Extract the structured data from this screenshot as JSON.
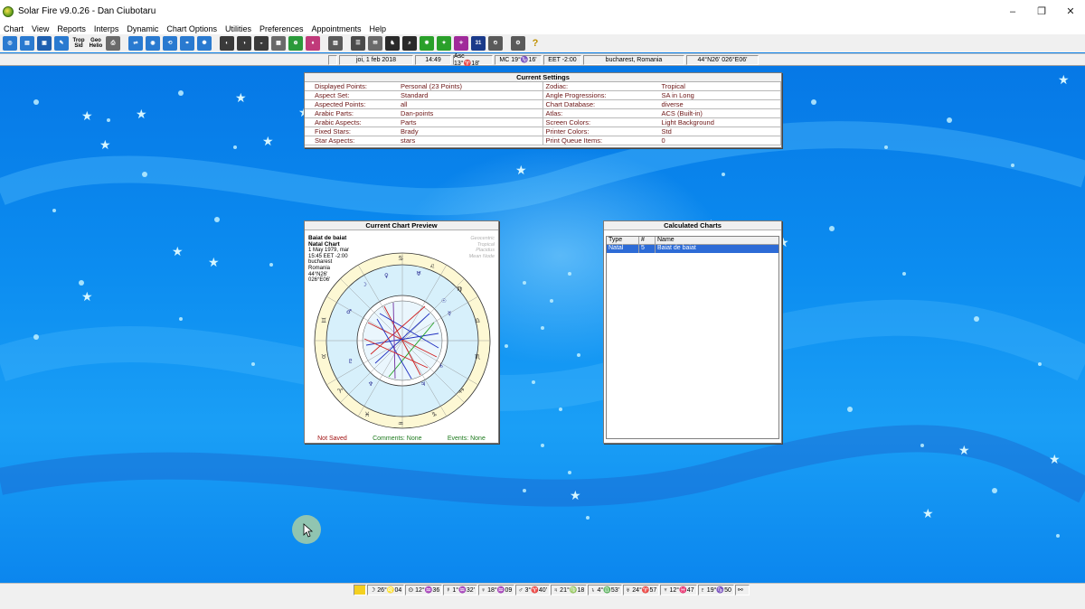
{
  "window": {
    "title": "Solar Fire v9.0.26  -  Dan Ciubotaru",
    "controls": [
      "–",
      "❐",
      "✕"
    ]
  },
  "menu": [
    "Chart",
    "View",
    "Reports",
    "Interps",
    "Dynamic",
    "Chart Options",
    "Utilities",
    "Preferences",
    "Appointments",
    "Help"
  ],
  "toolbar": {
    "trop_sid_label": "Trop\nSid",
    "geo_helio_label": "Geo\nHelio"
  },
  "infobar": {
    "date": "joi, 1 feb 2018",
    "time": "14:49",
    "asc": "Asc 13°♈18'",
    "mc": "MC 19°♑16'",
    "tz": "EET -2:00",
    "place": "bucharest, Romania",
    "coords": "44°N26' 026°E06'"
  },
  "settings": {
    "title": "Current Settings",
    "left": [
      {
        "k": "Displayed Points:",
        "v": "Personal  (23 Points)"
      },
      {
        "k": "Aspect Set:",
        "v": "Standard"
      },
      {
        "k": "Aspected Points:",
        "v": "all"
      },
      {
        "k": "Arabic Parts:",
        "v": "Dan-points"
      },
      {
        "k": "Arabic Aspects:",
        "v": "Parts"
      },
      {
        "k": "Fixed Stars:",
        "v": "Brady"
      },
      {
        "k": "Star Aspects:",
        "v": "stars"
      }
    ],
    "right": [
      {
        "k": "Zodiac:",
        "v": "Tropical"
      },
      {
        "k": "Angle Progressions:",
        "v": "SA in Long"
      },
      {
        "k": "Chart Database:",
        "v": "diverse"
      },
      {
        "k": "Atlas:",
        "v": "ACS  (Built-in)"
      },
      {
        "k": "Screen Colors:",
        "v": "Light Background"
      },
      {
        "k": "Printer Colors:",
        "v": "Std"
      },
      {
        "k": "Print Queue Items:",
        "v": "0"
      }
    ]
  },
  "preview": {
    "title": "Current Chart Preview",
    "name": "Baiat de baiat",
    "type": "Natal Chart",
    "date": "1 May 1979, mar",
    "time": "15:45  EET  -2:00",
    "city": "bucharest",
    "country": "Romania",
    "lat": "44°N26'",
    "lon": "026°E06'",
    "opts": [
      "Geocentric",
      "Tropical",
      "Placidus",
      "Mean Node"
    ],
    "footer_saved": "Not Saved",
    "footer_comments": "Comments: None",
    "footer_events": "Events: None"
  },
  "calc": {
    "title": "Calculated Charts",
    "headers": [
      "Type",
      "#",
      "Name"
    ],
    "rows": [
      {
        "type": "Natal",
        "num": "5",
        "name": "Baiat de baiat"
      }
    ]
  },
  "statusbar": [
    "☽ 26°♌04",
    "⊙ 12°♒36",
    "☿ 1°♒32'",
    "♀ 18°♒09",
    "♂ 3°♈40'",
    "♃ 21°♍18",
    "♄ 4°♎53'",
    "♅ 24°♈57",
    "♆ 12°♓47",
    "♇ 19°♑50"
  ],
  "colors": {
    "accent": "#2d6bd6",
    "label": "#6b1414",
    "desktop": "#0a7fe8"
  }
}
